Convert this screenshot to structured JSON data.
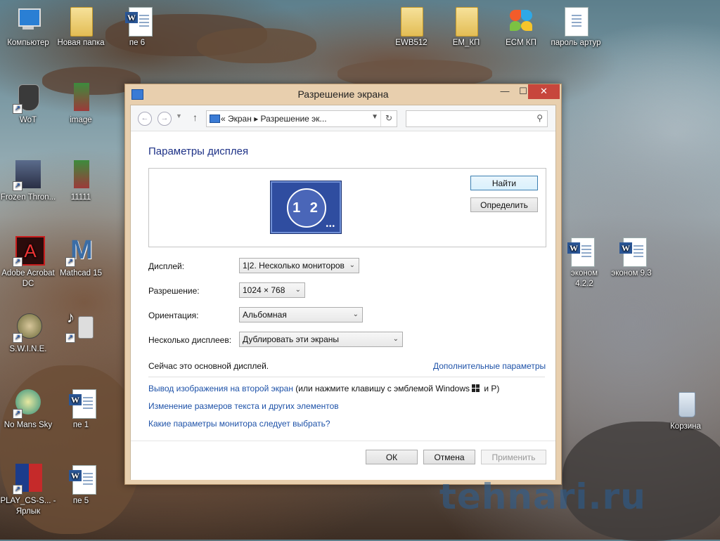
{
  "desktop": {
    "icons": [
      {
        "label": "Компьютер",
        "kind": "computer"
      },
      {
        "label": "Новая папка",
        "kind": "folder"
      },
      {
        "label": "пе 6",
        "kind": "word"
      },
      {
        "label": "EWB512",
        "kind": "folder"
      },
      {
        "label": "ЕМ_КП",
        "kind": "folder"
      },
      {
        "label": "ECM КП",
        "kind": "app"
      },
      {
        "label": "пароль артур",
        "kind": "text"
      },
      {
        "label": "WoT",
        "kind": "game"
      },
      {
        "label": "image",
        "kind": "image"
      },
      {
        "label": "Frozen Thron...",
        "kind": "game"
      },
      {
        "label": "11111",
        "kind": "image"
      },
      {
        "label": "Adobe Acrobat DC",
        "kind": "app"
      },
      {
        "label": "Mathcad 15",
        "kind": "app"
      },
      {
        "label": "S.W.I.N.E.",
        "kind": "game"
      },
      {
        "label": "No Mans Sky",
        "kind": "game"
      },
      {
        "label": "пе 1",
        "kind": "word"
      },
      {
        "label": "PLAY_CS-S... - Ярлык",
        "kind": "game"
      },
      {
        "label": "пе 5",
        "kind": "word"
      },
      {
        "label": "эконом 4.2.2",
        "kind": "word"
      },
      {
        "label": "эконом 9.3",
        "kind": "word"
      },
      {
        "label": "Корзина",
        "kind": "recycle-bin"
      }
    ]
  },
  "window": {
    "title": "Разрешение экрана",
    "minimize": "—",
    "maximize": "☐",
    "close": "✕"
  },
  "nav": {
    "back": "←",
    "forward": "→",
    "up": "↑",
    "breadcrumb": "«  Экран  ▸  Разрешение эк...",
    "refresh": "↻",
    "search_placeholder": ""
  },
  "content": {
    "heading": "Параметры дисплея",
    "monitor_numbers": "1 2",
    "find_button": "Найти",
    "identify_button": "Определить",
    "display_label": "Дисплей:",
    "display_value": "1|2. Несколько мониторов",
    "resolution_label": "Разрешение:",
    "resolution_value": "1024 × 768",
    "orientation_label": "Ориентация:",
    "orientation_value": "Альбомная",
    "multiple_label": "Несколько дисплеев:",
    "multiple_value": "Дублировать эти экраны",
    "status": "Сейчас это основной дисплей.",
    "advanced_link": "Дополнительные параметры",
    "project_link": "Вывод изображения на второй экран",
    "project_hint_a": " (или нажмите клавишу с эмблемой Windows",
    "project_hint_b": " и P)",
    "text_size_link": "Изменение размеров текста и других элементов",
    "which_settings_link": "Какие параметры монитора следует выбрать?",
    "ok": "ОК",
    "cancel": "Отмена",
    "apply": "Применить"
  },
  "watermark": "tehnari.ru"
}
